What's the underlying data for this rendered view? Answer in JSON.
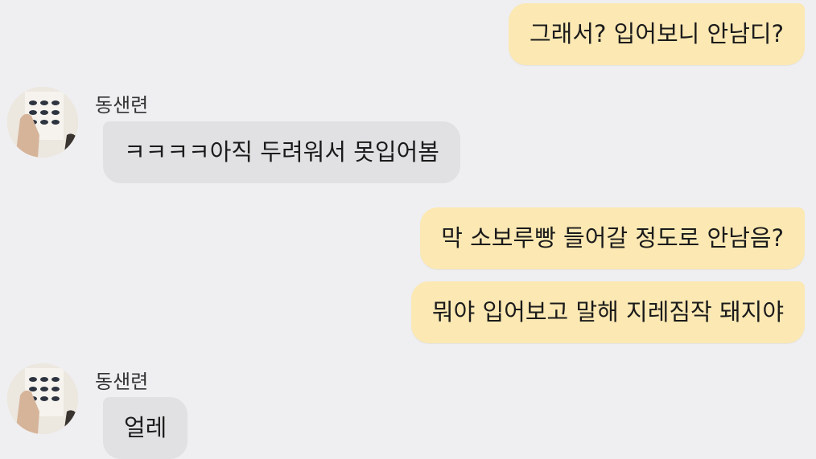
{
  "chat": {
    "messages": [
      {
        "side": "out",
        "text": "그래서? 입어보니 안남디?"
      },
      {
        "side": "in",
        "sender": "동샌련",
        "text": "ㅋㅋㅋㅋ아직 두려워서 못입어봄"
      },
      {
        "side": "out",
        "text": "막 소보루빵 들어갈 정도로 안남음?"
      },
      {
        "side": "out",
        "text": "뭐야 입어보고 말해 지레짐작 돼지야"
      },
      {
        "side": "in",
        "sender": "동샌련",
        "text": "얼레"
      }
    ]
  },
  "colors": {
    "background": "#efeff1",
    "outgoing_bubble": "#fbe8b3",
    "incoming_bubble": "#e1e1e4"
  }
}
